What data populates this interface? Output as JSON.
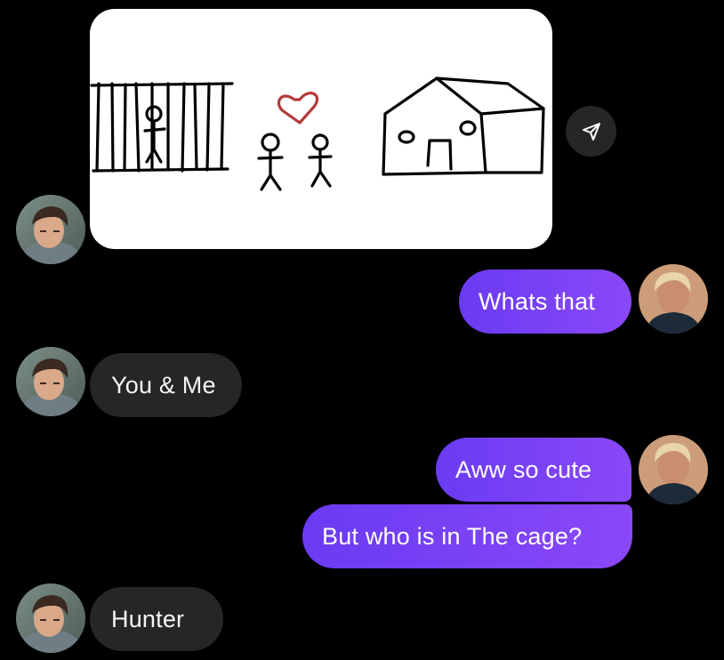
{
  "thread": {
    "messages": [
      {
        "from": "contact",
        "type": "image",
        "image_desc_icon": "drawing-attachment"
      },
      {
        "from": "me",
        "type": "text",
        "text": "Whats that"
      },
      {
        "from": "contact",
        "type": "text",
        "text": "You & Me"
      },
      {
        "from": "me",
        "type": "text",
        "text": "Aww so cute"
      },
      {
        "from": "me",
        "type": "text",
        "text": "But who is in The cage?"
      },
      {
        "from": "contact",
        "type": "text",
        "text": "Hunter"
      }
    ]
  },
  "icons": {
    "share": "send-arrow-icon"
  },
  "colors": {
    "background": "#000000",
    "incoming_bubble": "#262626",
    "outgoing_bubble_start": "#6a3bf2",
    "outgoing_bubble_end": "#8a48f8",
    "text_light": "#ffffff",
    "heart": "#b33a3a"
  }
}
